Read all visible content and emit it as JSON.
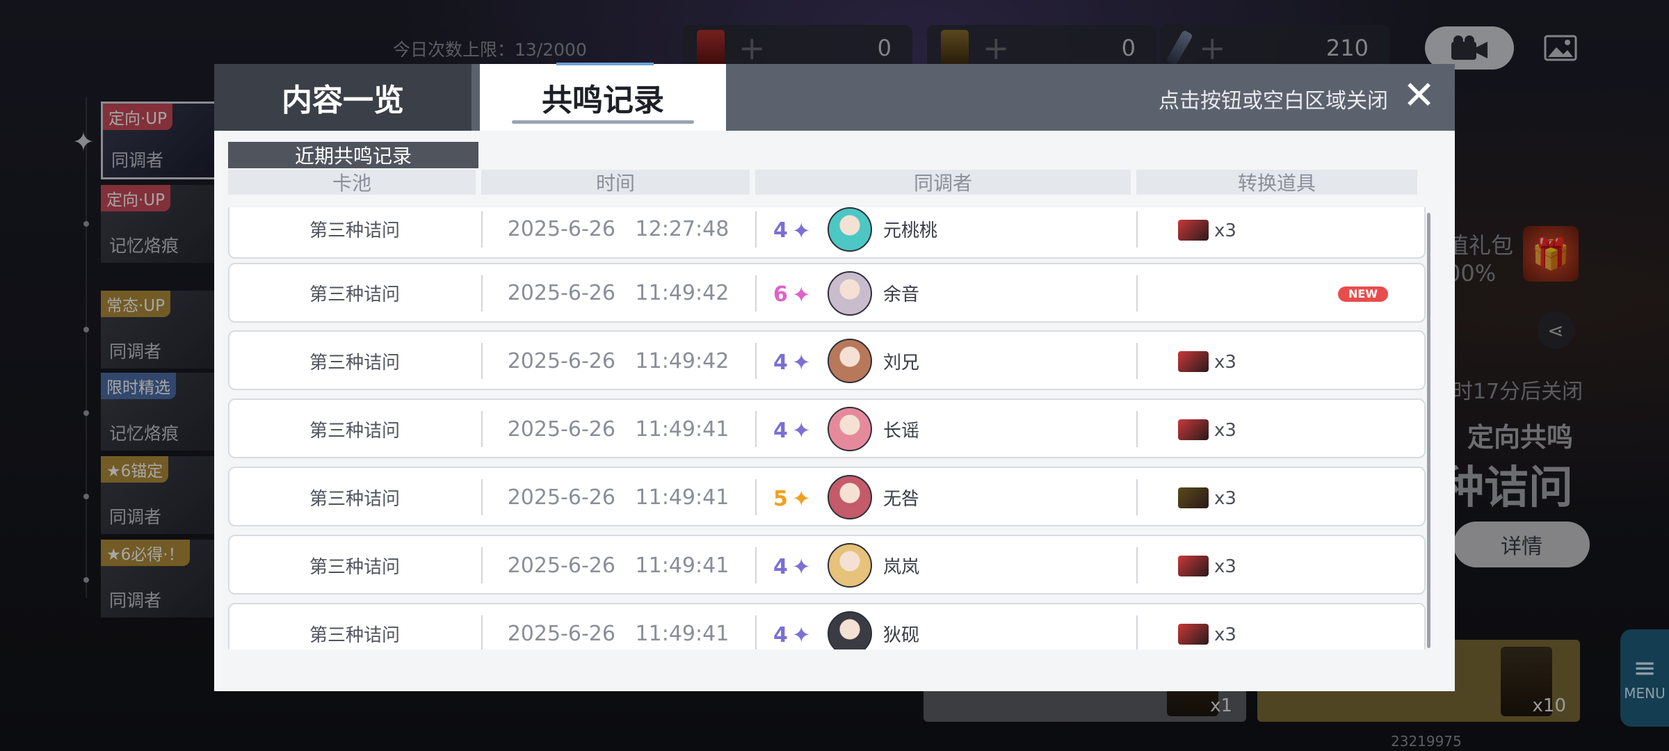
{
  "topbar": {
    "daily_limit": "今日次数上限：13/2000",
    "resources": [
      {
        "icon": "limited-ticket-icon",
        "value": "0"
      },
      {
        "icon": "standard-ticket-icon",
        "value": "0"
      },
      {
        "icon": "crystal-pen-icon",
        "value": "210"
      }
    ]
  },
  "left_banners": [
    {
      "tag": "定向·UP",
      "title": "同调者",
      "tag_color": "#c94b59"
    },
    {
      "tag": "定向·UP",
      "title": "记忆烙痕",
      "tag_color": "#c94b59"
    },
    {
      "tag": "常态·UP",
      "title": "同调者",
      "tag_color": "#b08c3a"
    },
    {
      "tag": "限时精选",
      "title": "记忆烙痕",
      "tag_color": "#4d6ea8"
    },
    {
      "tag": "★6锚定",
      "title": "同调者",
      "tag_color": "#b08c3a"
    },
    {
      "tag": "★6必得·！",
      "title": "同调者",
      "tag_color": "#b08c3a"
    }
  ],
  "right_panel": {
    "gift_text_line1": "值礼包",
    "gift_text_line2": "00%",
    "timer": "时17分后关闭",
    "banner_sub": "定向共鸣",
    "banner_title": "种诘问",
    "details_label": "详情",
    "menu_label": "MENU",
    "pull1_count": "x1",
    "pull10_count": "x10",
    "uid": "23219975"
  },
  "modal": {
    "tabs": [
      "内容一览",
      "共鸣记录"
    ],
    "close_hint": "点击按钮或空白区域关闭",
    "close_symbol": "✕",
    "section_label": "近期共鸣记录",
    "columns": [
      "卡池",
      "时间",
      "同调者",
      "转换道具"
    ],
    "rows": [
      {
        "pool": "第三种诘问",
        "time": "2025-6-26   12:27:48",
        "rarity": "4",
        "name": "元桃桃",
        "item_qty": "x3",
        "item": "red-card",
        "new": ""
      },
      {
        "pool": "第三种诘问",
        "time": "2025-6-26   11:49:42",
        "rarity": "6",
        "name": "余音",
        "item_qty": "",
        "item": "",
        "new": "NEW"
      },
      {
        "pool": "第三种诘问",
        "time": "2025-6-26   11:49:42",
        "rarity": "4",
        "name": "刘兄",
        "item_qty": "x3",
        "item": "red-card",
        "new": ""
      },
      {
        "pool": "第三种诘问",
        "time": "2025-6-26   11:49:41",
        "rarity": "4",
        "name": "长谣",
        "item_qty": "x3",
        "item": "red-card",
        "new": ""
      },
      {
        "pool": "第三种诘问",
        "time": "2025-6-26   11:49:41",
        "rarity": "5",
        "name": "无咎",
        "item_qty": "x3",
        "item": "gold-card",
        "new": ""
      },
      {
        "pool": "第三种诘问",
        "time": "2025-6-26   11:49:41",
        "rarity": "4",
        "name": "岚岚",
        "item_qty": "x3",
        "item": "red-card",
        "new": ""
      },
      {
        "pool": "第三种诘问",
        "time": "2025-6-26   11:49:41",
        "rarity": "4",
        "name": "狄砚",
        "item_qty": "x3",
        "item": "red-card",
        "new": ""
      }
    ]
  },
  "colors": {
    "rarity_4": "#7b6fd6",
    "rarity_5": "#f0a020",
    "rarity_6": "#e060c8",
    "red_card": "#c8383a",
    "gold_card": "#5a4a1a",
    "avatars": [
      "#4cc7c4",
      "#c8bccd",
      "#b8785a",
      "#e58a9a",
      "#c45a6a",
      "#e6c27a",
      "#3b3b44"
    ]
  }
}
